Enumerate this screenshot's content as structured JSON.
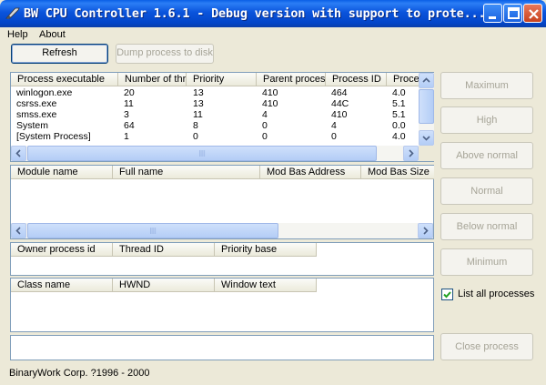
{
  "window": {
    "title": "BW CPU Controller 1.6.1 - Debug version with support to prote..."
  },
  "menu": {
    "items": [
      "Help",
      "About"
    ]
  },
  "toolbar": {
    "refresh_label": "Refresh",
    "dump_label": "Dump process to disk"
  },
  "process_table": {
    "columns": [
      "Process executable",
      "Number of thr...",
      "Priority",
      "Parent process",
      "Process ID",
      "Proces"
    ],
    "rows": [
      [
        "winlogon.exe",
        "20",
        "13",
        "410",
        "464",
        "4.0"
      ],
      [
        "csrss.exe",
        "11",
        "13",
        "410",
        "44C",
        "5.1"
      ],
      [
        "smss.exe",
        "3",
        "11",
        "4",
        "410",
        "5.1"
      ],
      [
        "System",
        "64",
        "8",
        "0",
        "4",
        "0.0"
      ],
      [
        "[System Process]",
        "1",
        "0",
        "0",
        "0",
        "4.0"
      ]
    ]
  },
  "module_table": {
    "columns": [
      "Module name",
      "Full name",
      "Mod Bas Address",
      "Mod Bas Size"
    ]
  },
  "thread_table": {
    "columns": [
      "Owner process id",
      "Thread ID",
      "Priority base"
    ]
  },
  "window_table": {
    "columns": [
      "Class name",
      "HWND",
      "Window text"
    ]
  },
  "priority_buttons": [
    "Maximum",
    "High",
    "Above normal",
    "Normal",
    "Below normal",
    "Minimum"
  ],
  "list_all": {
    "label": "List all processes",
    "checked": true
  },
  "close_process_label": "Close process",
  "status": {
    "text": "BinaryWork Corp. ?1996 - 2000"
  }
}
